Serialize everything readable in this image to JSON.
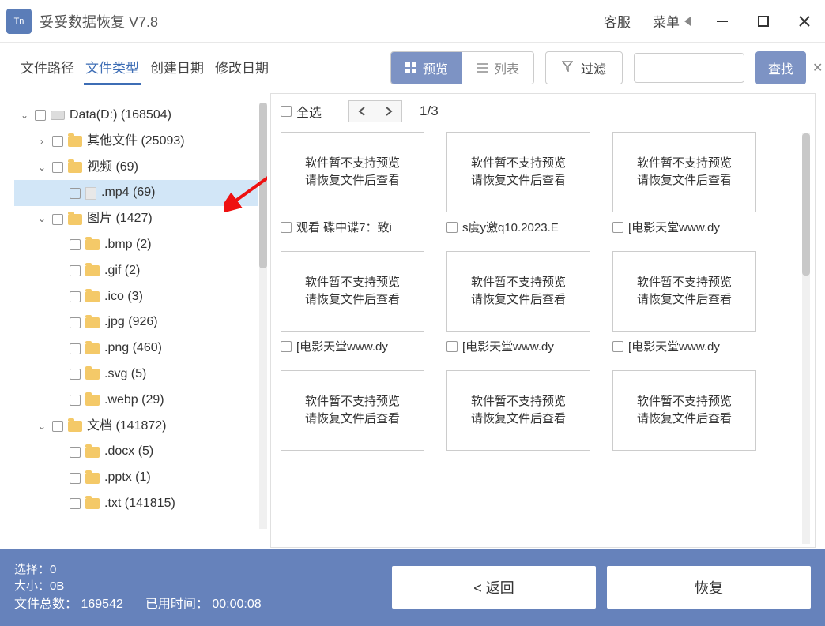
{
  "titlebar": {
    "app_name": "妥妥数据恢复  V7.8",
    "support": "客服",
    "menu": "菜单"
  },
  "toolbar": {
    "tabs": [
      "文件路径",
      "文件类型",
      "创建日期",
      "修改日期"
    ],
    "active_tab": 1,
    "preview": "预览",
    "list": "列表",
    "filter": "过滤",
    "find": "查找",
    "search_value": ""
  },
  "tree": [
    {
      "ind": 0,
      "caret": "down",
      "icon": "disk",
      "label": "Data(D:)  (168504)"
    },
    {
      "ind": 1,
      "caret": "right",
      "icon": "folder",
      "label": "其他文件  (25093)"
    },
    {
      "ind": 1,
      "caret": "down",
      "icon": "folder",
      "label": "视频  (69)"
    },
    {
      "ind": 2,
      "caret": "",
      "icon": "file",
      "label": ".mp4  (69)",
      "selected": true
    },
    {
      "ind": 1,
      "caret": "down",
      "icon": "folder",
      "label": "图片  (1427)"
    },
    {
      "ind": 2,
      "caret": "",
      "icon": "folder",
      "label": ".bmp  (2)"
    },
    {
      "ind": 2,
      "caret": "",
      "icon": "folder",
      "label": ".gif  (2)"
    },
    {
      "ind": 2,
      "caret": "",
      "icon": "folder",
      "label": ".ico  (3)"
    },
    {
      "ind": 2,
      "caret": "",
      "icon": "folder",
      "label": ".jpg  (926)"
    },
    {
      "ind": 2,
      "caret": "",
      "icon": "folder",
      "label": ".png  (460)"
    },
    {
      "ind": 2,
      "caret": "",
      "icon": "folder",
      "label": ".svg  (5)"
    },
    {
      "ind": 2,
      "caret": "",
      "icon": "folder",
      "label": ".webp  (29)"
    },
    {
      "ind": 1,
      "caret": "down",
      "icon": "folder",
      "label": "文档  (141872)"
    },
    {
      "ind": 2,
      "caret": "",
      "icon": "folder",
      "label": ".docx  (5)"
    },
    {
      "ind": 2,
      "caret": "",
      "icon": "folder",
      "label": ".pptx  (1)"
    },
    {
      "ind": 2,
      "caret": "",
      "icon": "folder",
      "label": ".txt  (141815)"
    }
  ],
  "grid": {
    "select_all": "全选",
    "page": "1/3",
    "no_preview_l1": "软件暂不支持预览",
    "no_preview_l2": "请恢复文件后查看",
    "items": [
      "观看 碟中谍7：致i",
      "s度y激q10.2023.E",
      "[电影天堂www.dy",
      "[电影天堂www.dy",
      "[电影天堂www.dy",
      "[电影天堂www.dy",
      "",
      "",
      ""
    ]
  },
  "bottom": {
    "sel_label": "选择：",
    "sel_value": "0",
    "size_label": "大小：",
    "size_value": "0B",
    "total_label": "文件总数：",
    "total_value": "169542",
    "time_label": "已用时间：",
    "time_value": "00:00:08",
    "back": "< 返回",
    "recover": "恢复"
  }
}
